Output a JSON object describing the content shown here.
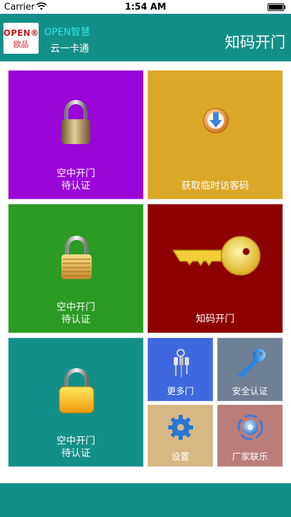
{
  "status_bar": {
    "carrier": "Carrier",
    "time": "1:54 AM"
  },
  "header": {
    "logo_brand": "OPEN®",
    "logo_sub": "欧品",
    "tagline": "OPEN智慧",
    "subtitle": "云一卡通",
    "title": "知码开门"
  },
  "tiles": [
    {
      "label": "空中开门\n待认证",
      "icon": "padlock-bronze-icon",
      "color": "#9a05d8"
    },
    {
      "label": "获取临时访客码",
      "icon": "download-arrow-icon",
      "color": "#dba726"
    },
    {
      "label": "空中开门\n待认证",
      "icon": "padlock-gold-icon",
      "color": "#2b9b24"
    },
    {
      "label": "知码开门",
      "icon": "key-icon",
      "color": "#8d0000"
    },
    {
      "label": "空中开门\n待认证",
      "icon": "padlock-yellow-icon",
      "color": "#138f8a"
    },
    {
      "label": "更多门",
      "icon": "keys-bundle-icon",
      "color": "#3f68de"
    },
    {
      "label": "安全认证",
      "icon": "blue-key-icon",
      "color": "#6f7f96"
    },
    {
      "label": "设置",
      "icon": "gear-icon",
      "color": "#d7b884"
    },
    {
      "label": "厂家联乐",
      "icon": "contact-globe-icon",
      "color": "#b97d7a"
    }
  ]
}
